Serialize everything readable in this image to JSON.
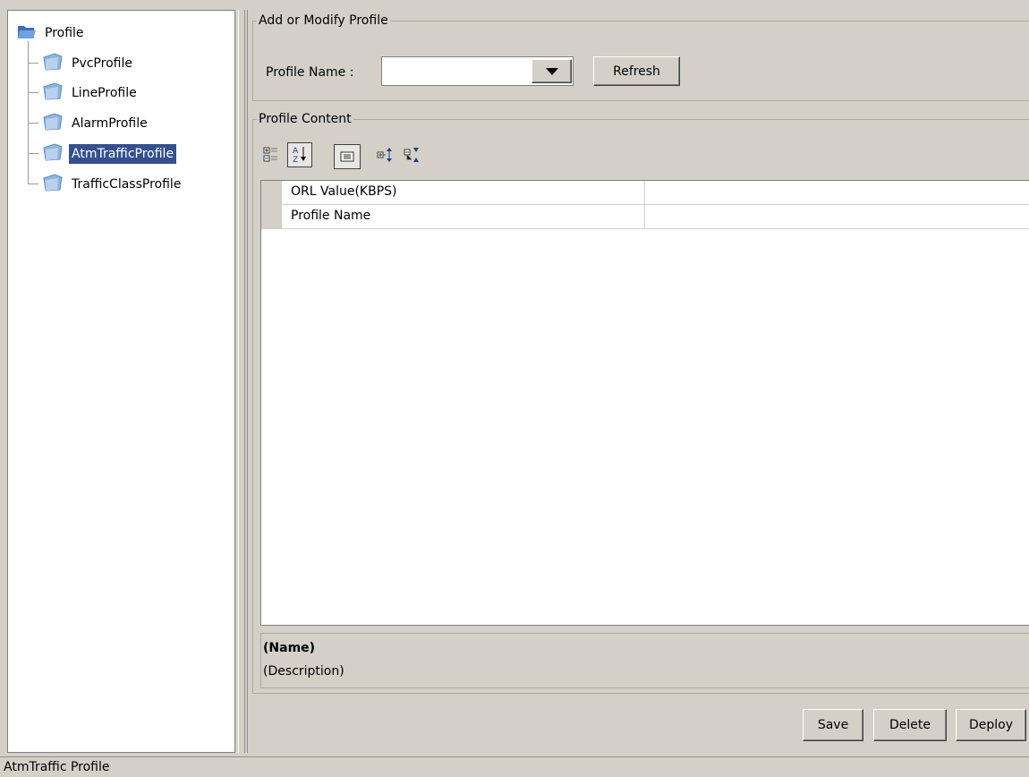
{
  "tree": {
    "root": {
      "label": "Profile",
      "icon": "open-folder-icon"
    },
    "items": [
      {
        "label": "PvcProfile",
        "icon": "folder-icon",
        "selected": false
      },
      {
        "label": "LineProfile",
        "icon": "folder-icon",
        "selected": false
      },
      {
        "label": "AlarmProfile",
        "icon": "folder-icon",
        "selected": false
      },
      {
        "label": "AtmTrafficProfile",
        "icon": "folder-icon",
        "selected": true
      },
      {
        "label": "TrafficClassProfile",
        "icon": "folder-icon",
        "selected": false
      }
    ]
  },
  "add_section": {
    "legend": "Add or Modify Profile",
    "profile_name_label": "Profile Name :",
    "profile_name_value": "",
    "refresh_label": "Refresh"
  },
  "content_section": {
    "legend": "Profile Content",
    "toolbar": [
      {
        "icon": "categorized-view-icon",
        "pressed": false
      },
      {
        "icon": "sort-alphabetical-icon",
        "pressed": true
      },
      {
        "icon": "description-toggle-icon",
        "pressed": true
      },
      {
        "icon": "expand-all-icon",
        "pressed": false
      },
      {
        "icon": "collapse-all-icon",
        "pressed": false
      }
    ],
    "properties": [
      {
        "name": "ORL Value(KBPS)",
        "value": ""
      },
      {
        "name": "Profile Name",
        "value": ""
      }
    ],
    "description": {
      "name": "(Name)",
      "text": "(Description)"
    }
  },
  "actions": {
    "save_label": "Save",
    "delete_label": "Delete",
    "deploy_label": "Deploy"
  },
  "status_bar": {
    "text": "AtmTraffic Profile"
  },
  "colors": {
    "selection": "#34508f",
    "background": "#d4d0c8",
    "folder": "#5b8fd0"
  }
}
